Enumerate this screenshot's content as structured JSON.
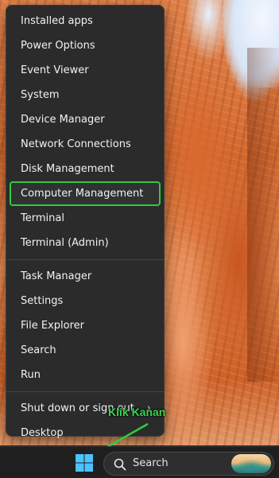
{
  "menu": {
    "items": [
      {
        "label": "Installed apps"
      },
      {
        "label": "Power Options"
      },
      {
        "label": "Event Viewer"
      },
      {
        "label": "System"
      },
      {
        "label": "Device Manager"
      },
      {
        "label": "Network Connections"
      },
      {
        "label": "Disk Management"
      },
      {
        "label": "Computer Management"
      },
      {
        "label": "Terminal"
      },
      {
        "label": "Terminal (Admin)"
      },
      {
        "label": "Task Manager"
      },
      {
        "label": "Settings"
      },
      {
        "label": "File Explorer"
      },
      {
        "label": "Search"
      },
      {
        "label": "Run"
      },
      {
        "label": "Shut down or sign out"
      },
      {
        "label": "Desktop"
      }
    ],
    "chevron": "›"
  },
  "annotation": {
    "text": "Klik Kanan",
    "color": "#39d64a"
  },
  "highlight_color": "#2ecc40",
  "taskbar": {
    "start_icon": "windows-logo-icon",
    "search": {
      "label": "Search",
      "icon": "search-icon"
    }
  }
}
